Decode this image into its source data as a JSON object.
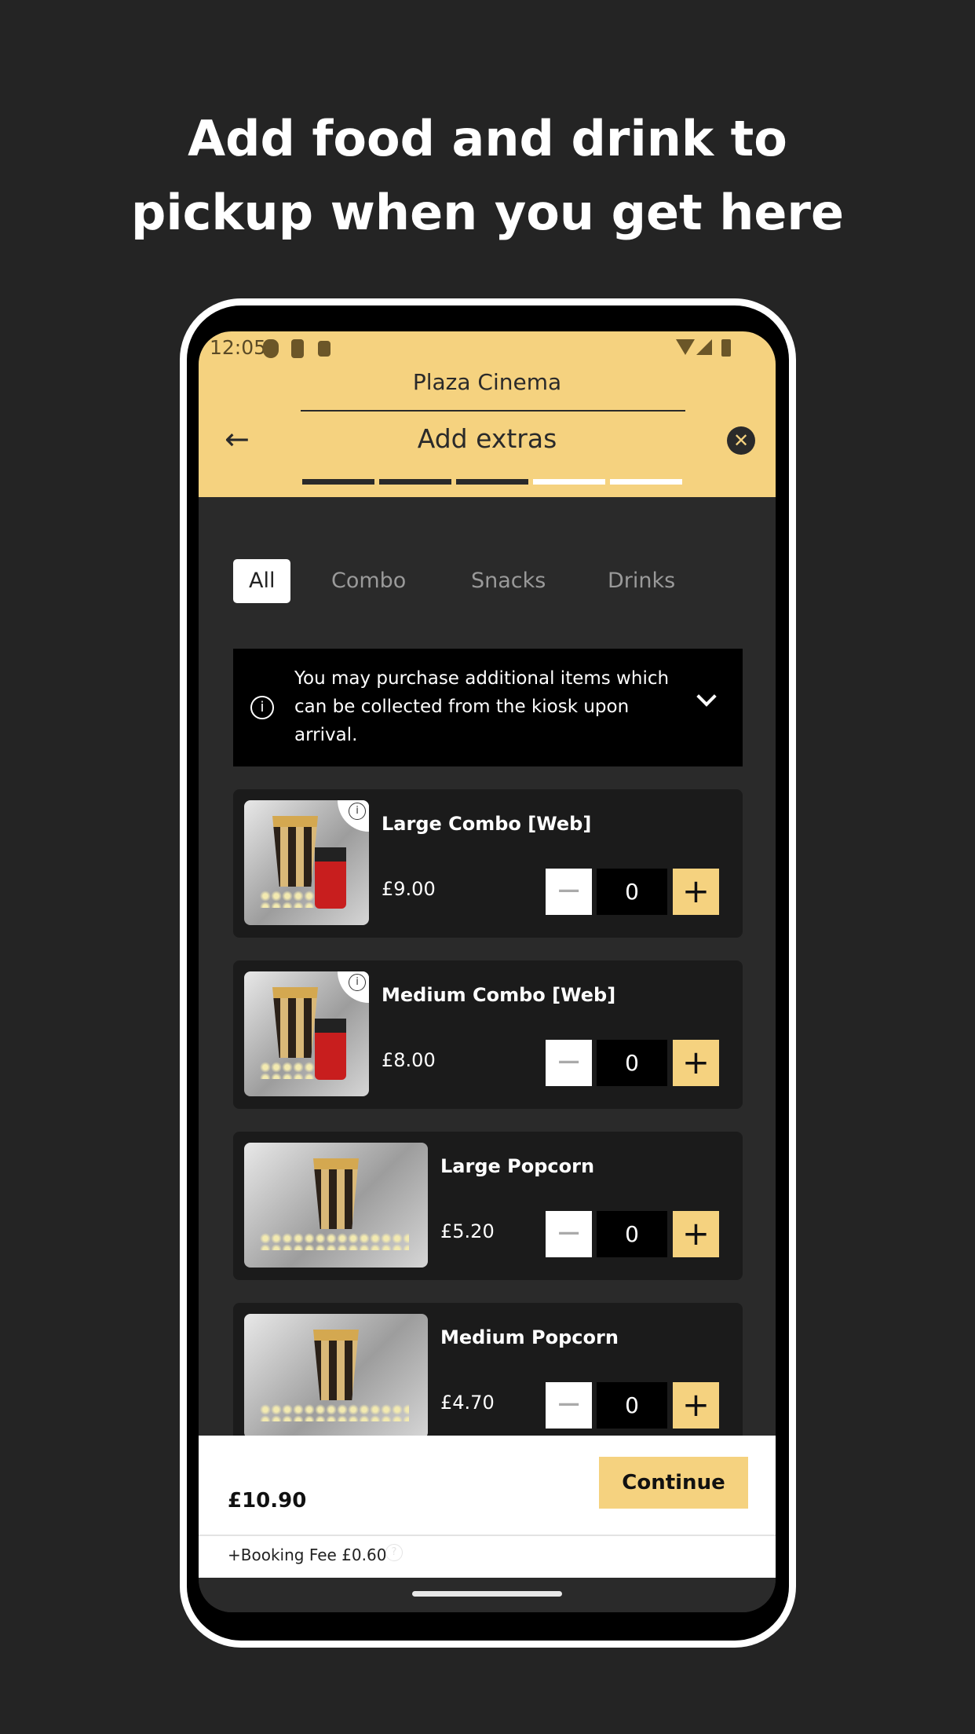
{
  "headline": {
    "line1": "Add food and drink to",
    "line2": "pickup when you get here"
  },
  "status_bar": {
    "time": "12:05"
  },
  "header": {
    "cinema": "Plaza Cinema",
    "title": "Add extras",
    "steps_total": 5,
    "steps_completed": 3
  },
  "colors": {
    "accent": "#f5d27f",
    "background": "#2a2a2a",
    "card": "#1b1b1b"
  },
  "tabs": [
    {
      "label": "All",
      "active": true
    },
    {
      "label": "Combo"
    },
    {
      "label": "Snacks"
    },
    {
      "label": "Drinks"
    }
  ],
  "info": {
    "text": "You may purchase additional items which can be collected from the kiosk upon arrival."
  },
  "items": [
    {
      "name": "Large Combo [Web]",
      "price": "£9.00",
      "qty": "0",
      "image": "popcorn-and-coke"
    },
    {
      "name": "Medium Combo [Web]",
      "price": "£8.00",
      "qty": "0",
      "image": "popcorn-and-coke"
    },
    {
      "name": "Large Popcorn",
      "price": "£5.20",
      "qty": "0",
      "image": "popcorn"
    },
    {
      "name": "Medium Popcorn",
      "price": "£4.70",
      "qty": "0",
      "image": "popcorn"
    }
  ],
  "stepper": {
    "minus": "−",
    "plus": "+"
  },
  "footer": {
    "total": "£10.90",
    "continue": "Continue",
    "booking_fee": "+Booking Fee £0.60"
  }
}
